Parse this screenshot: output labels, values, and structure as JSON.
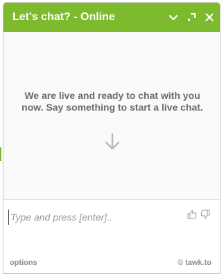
{
  "header": {
    "title": "Let's chat? - Online",
    "color": "#7dba2d"
  },
  "messages": {
    "welcome": "We are live and ready to chat with you now. Say something to start a live chat."
  },
  "composer": {
    "placeholder": "Type and press [enter].."
  },
  "footer": {
    "options_label": "options",
    "branding_label": "© tawk.to"
  },
  "icons": {
    "minimize": "chevron-down-icon",
    "popout": "popout-icon",
    "close": "close-icon",
    "arrow": "arrow-down-icon",
    "rate_up": "thumbs-up-icon",
    "rate_down": "thumbs-down-icon"
  }
}
